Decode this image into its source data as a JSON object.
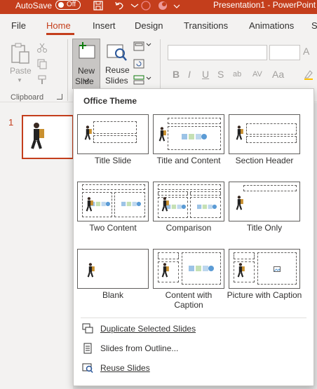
{
  "titlebar": {
    "autosave_label": "AutoSave",
    "autosave_state": "Off",
    "document_title": "Presentation1  -  PowerPoint"
  },
  "tabs": [
    "File",
    "Home",
    "Insert",
    "Design",
    "Transitions",
    "Animations",
    "S"
  ],
  "active_tab": "Home",
  "ribbon": {
    "paste_label": "Paste",
    "clipboard_group_label": "Clipboard",
    "new_slide_line1": "New",
    "new_slide_line2": "Slide",
    "reuse_slides_line1": "Reuse",
    "reuse_slides_line2": "Slides",
    "font_name": "",
    "font_size": "",
    "format_buttons": [
      "B",
      "I",
      "U",
      "S",
      "ab",
      "AV",
      "Aa"
    ]
  },
  "slides_panel": {
    "slide_number": "1"
  },
  "new_slide_menu": {
    "heading": "Office Theme",
    "layouts": [
      {
        "label": "Title Slide"
      },
      {
        "label": "Title and Content"
      },
      {
        "label": "Section Header"
      },
      {
        "label": "Two Content"
      },
      {
        "label": "Comparison"
      },
      {
        "label": "Title Only"
      },
      {
        "label": "Blank"
      },
      {
        "label": "Content with Caption"
      },
      {
        "label": "Picture with Caption"
      }
    ],
    "commands": [
      {
        "label": "Duplicate Selected Slides",
        "icon": "duplicate-slides-icon"
      },
      {
        "label": "Slides from Outline...",
        "icon": "outline-icon"
      },
      {
        "label": "Reuse Slides",
        "icon": "reuse-slides-icon"
      }
    ]
  },
  "colors": {
    "accent": "#c43e1c",
    "ribbon_bg": "#f3f2f1"
  }
}
